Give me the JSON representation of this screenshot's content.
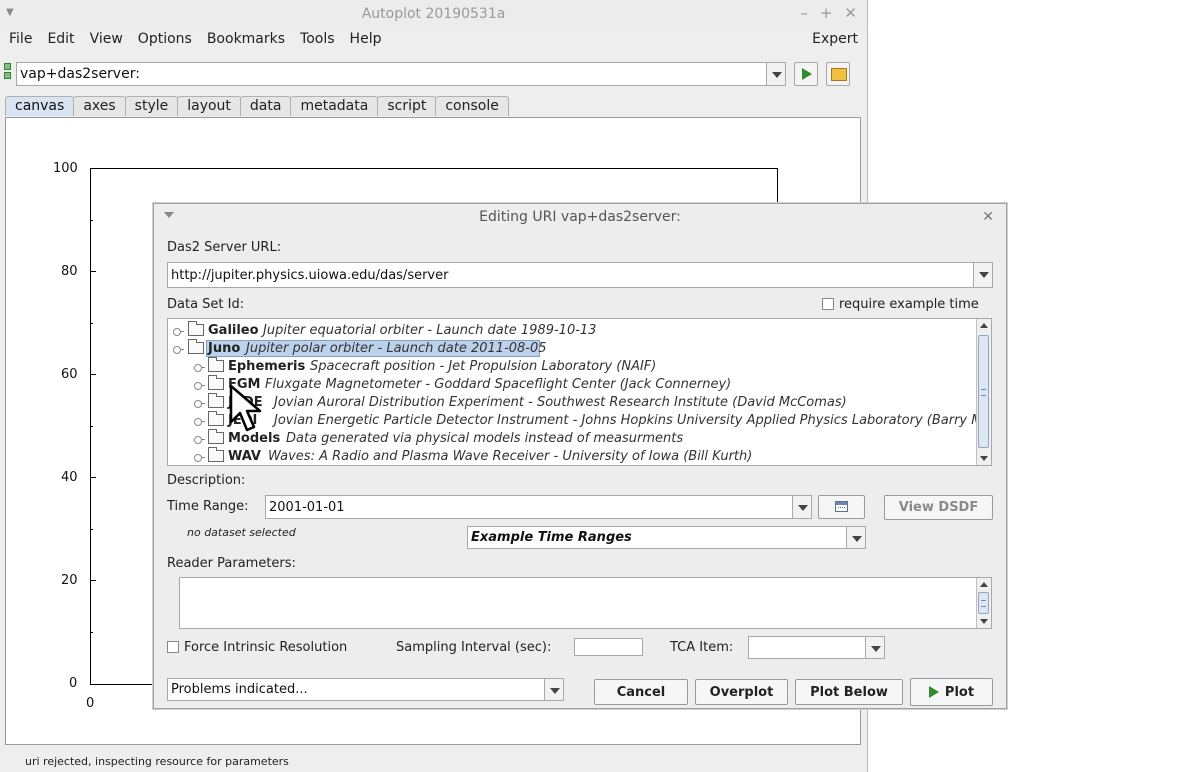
{
  "main_window": {
    "title": "Autoplot 20190531a",
    "menu": [
      "File",
      "Edit",
      "View",
      "Options",
      "Bookmarks",
      "Tools",
      "Help"
    ],
    "menu_right": "Expert",
    "uri_value": "vap+das2server:",
    "tabs": [
      "canvas",
      "axes",
      "style",
      "layout",
      "data",
      "metadata",
      "script",
      "console"
    ],
    "active_tab": "canvas",
    "status_text": "uri rejected, inspecting resource for parameters"
  },
  "plot": {
    "y_ticks": [
      "100",
      "80",
      "60",
      "40",
      "20",
      "0"
    ],
    "x_ticks": [
      "0"
    ]
  },
  "dialog": {
    "title": "Editing URI vap+das2server:",
    "server_url_label": "Das2 Server URL:",
    "server_url": "http://jupiter.physics.uiowa.edu/das/server",
    "dataset_id_label": "Data Set Id:",
    "require_example_label": "require example time",
    "tree": [
      {
        "name": "Galileo",
        "desc": "Jupiter equatorial orbiter - Launch date 1989-10-13",
        "level": 0
      },
      {
        "name": "Juno",
        "desc": "Jupiter polar orbiter - Launch date 2011-08-05",
        "level": 0,
        "selected": true
      },
      {
        "name": "Ephemeris",
        "desc": "Spacecraft position - Jet Propulsion Laboratory (NAIF)",
        "level": 1
      },
      {
        "name": "FGM",
        "desc": "Fluxgate Magnetometer - Goddard Spaceflight Center (Jack Connerney)",
        "level": 1
      },
      {
        "name": "JADE",
        "desc": "Jovian Auroral Distribution Experiment - Southwest Research Institute (David McComas)",
        "level": 1
      },
      {
        "name": "JEDI",
        "desc": "Jovian Energetic Particle Detector Instrument - Johns Hopkins University Applied Physics Laboratory (Barry Mauk)",
        "level": 1
      },
      {
        "name": "Models",
        "desc": "Data generated via physical models instead of measurments",
        "level": 1
      },
      {
        "name": "WAV",
        "desc": "Waves: A Radio and Plasma Wave Receiver - University of Iowa (Bill Kurth)",
        "level": 1
      }
    ],
    "description_label": "Description:",
    "time_range_label": "Time Range:",
    "time_range": "2001-01-01",
    "view_dsdf": "View DSDF",
    "no_dataset": "no dataset selected",
    "example_time_ranges": "Example Time Ranges",
    "reader_params_label": "Reader Parameters:",
    "force_intrinsic_label": "Force Intrinsic Resolution",
    "sampling_interval_label": "Sampling Interval (sec):",
    "tca_item_label": "TCA Item:",
    "problems": "Problems indicated...",
    "cancel": "Cancel",
    "overplot": "Overplot",
    "plot_below": "Plot Below",
    "plot": "Plot"
  }
}
